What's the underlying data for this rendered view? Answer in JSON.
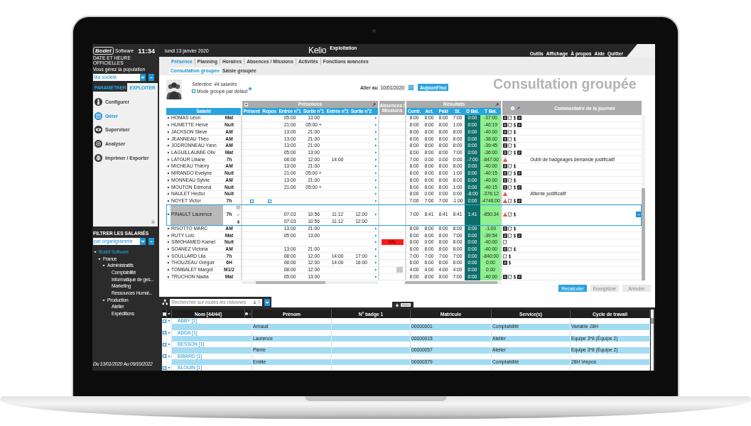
{
  "sidebar": {
    "logo": {
      "name": "Bodet",
      "subtitle": "Software",
      "tagline": "DATE ET HEURE OFFICIELLES"
    },
    "clock": "11:34",
    "population_label": "Vous gérez la population",
    "population_select": {
      "value": "Ma société"
    },
    "mode_tabs": [
      {
        "label": "PARAMÉTRER",
        "selected": false
      },
      {
        "label": "EXPLOITER",
        "selected": true
      }
    ],
    "menu": [
      {
        "label": "Configurer",
        "selected": false
      },
      {
        "label": "Gérer",
        "selected": true
      },
      {
        "label": "Superviser",
        "selected": false
      },
      {
        "label": "Analyser",
        "selected": false
      },
      {
        "label": "Imprimer / Exporter",
        "selected": false
      }
    ],
    "filter_title": "FILTRER LES SALARIÉS",
    "filter_select": {
      "value": "par organigramme"
    },
    "tree": [
      {
        "label": "Bodet Software",
        "selected": true,
        "expanded": true,
        "children": [
          {
            "label": "France",
            "selected": false,
            "expanded": true,
            "children": [
              {
                "label": "Administratifs",
                "selected": false,
                "expanded": true,
                "children": [
                  {
                    "label": "Comptabilité",
                    "selected": false
                  },
                  {
                    "label": "Informatique de ges...",
                    "selected": false
                  },
                  {
                    "label": "Marketing",
                    "selected": false
                  },
                  {
                    "label": "Ressources Humai...",
                    "selected": false
                  }
                ]
              },
              {
                "label": "Production",
                "selected": false,
                "expanded": true,
                "children": [
                  {
                    "label": "Atelier",
                    "selected": false
                  },
                  {
                    "label": "Expéditions",
                    "selected": false
                  }
                ]
              }
            ]
          }
        ]
      }
    ],
    "period": "Du 13/01/2020 Au 09/10/2022"
  },
  "topbar": {
    "date": "lundi 13 janvier 2020",
    "logo": "Kelio",
    "module": "Exploitation",
    "menu": [
      "Outils",
      "Affichage",
      "À propos",
      "Aide",
      "Quitter"
    ]
  },
  "tabs": [
    {
      "label": "Présence",
      "selected": true
    },
    {
      "label": "Planning",
      "selected": false
    },
    {
      "label": "Horaires",
      "selected": false
    },
    {
      "label": "Absences / Missions",
      "selected": false
    },
    {
      "label": "Activités",
      "selected": false
    },
    {
      "label": "Fonctions avancées",
      "selected": false
    }
  ],
  "subtabs": [
    {
      "label": "Consultation groupée",
      "selected": true
    },
    {
      "label": "Saisie groupée",
      "selected": false
    }
  ],
  "consultation": {
    "selection": "Sélection: 44 salariés",
    "grouped_mode": {
      "label": "Mode groupé par défaut",
      "checked": false
    },
    "goto": {
      "label": "Aller au",
      "value": "10/01/2020",
      "today_button": "Aujourd'hui"
    },
    "title": "Consultation groupée"
  },
  "grid": {
    "employee_header": "Salarié",
    "presences": {
      "title": "Présences",
      "columns": [
        "Présent",
        "Repos",
        "Entrée n°1",
        "Sortie n°1",
        "Entrée n°2",
        "Sortie n°2"
      ]
    },
    "absences_header": "Absences / Missions",
    "results": {
      "title": "Résultats",
      "columns": [
        "Contr.",
        "Act.",
        "Paid",
        "St.",
        "D Bal.",
        "T Bal."
      ]
    },
    "comment_header": "Commentaire de la journée",
    "rows": [
      {
        "name": "HOMAS Léon",
        "cycle": "Mat",
        "selected": false,
        "expanded": false,
        "punches": [
          "05:00",
          "13:00"
        ],
        "results": [
          "8:00",
          "8:00",
          "8:00",
          "7:00",
          "0:00",
          "-37:00"
        ],
        "flags": {
          "warning": false,
          "schedule": true,
          "note": true,
          "pay": true,
          "swap": true
        }
      },
      {
        "name": "HUMETTE Hervé",
        "cycle": "Nuit",
        "selected": false,
        "expanded": false,
        "punches": [
          "21:00",
          "05:00 +"
        ],
        "results": [
          "8:00",
          "8:00",
          "8:00",
          "1:00",
          "0:00",
          "-40:19"
        ],
        "flags": {
          "warning": false,
          "schedule": true,
          "note": true,
          "pay": true,
          "swap": true
        }
      },
      {
        "name": "JACKSON Steve",
        "cycle": "AM",
        "selected": false,
        "expanded": false,
        "punches": [
          "13:00",
          "21:00"
        ],
        "results": [
          "8:00",
          "8:00",
          "8:00",
          "8:00",
          "0:00",
          "-40:00"
        ],
        "flags": {
          "warning": false,
          "schedule": true,
          "note": true,
          "pay": true,
          "swap": false
        }
      },
      {
        "name": "JEANNEAU Théo",
        "cycle": "AM",
        "selected": false,
        "expanded": false,
        "punches": [
          "13:00",
          "21:00"
        ],
        "results": [
          "8:00",
          "8:00",
          "8:00",
          "8:00",
          "0:00",
          "-38:00"
        ],
        "flags": {
          "warning": false,
          "schedule": true,
          "note": true,
          "pay": true,
          "swap": false
        }
      },
      {
        "name": "JODRONNEAU Yann",
        "cycle": "AM",
        "selected": false,
        "expanded": false,
        "punches": [
          "13:00",
          "21:00"
        ],
        "results": [
          "8:00",
          "8:00",
          "8:00",
          "8:00",
          "0:00",
          "-39:45"
        ],
        "flags": {
          "warning": false,
          "schedule": true,
          "note": true,
          "pay": true,
          "swap": false
        }
      },
      {
        "name": "LAGUILLAUMIE Oliv",
        "cycle": "Mat",
        "selected": false,
        "expanded": false,
        "punches": [
          "05:00",
          "13:00"
        ],
        "results": [
          "8:00",
          "8:00",
          "8:00",
          "7:00",
          "0:00",
          "-36:00"
        ],
        "flags": {
          "warning": false,
          "schedule": true,
          "note": true,
          "pay": true,
          "swap": true
        }
      },
      {
        "name": "LATOUR Liliane",
        "cycle": "7h",
        "selected": false,
        "expanded": false,
        "punches": [
          "08:00",
          "12:00",
          "14:00"
        ],
        "results": [
          "7:00",
          "0:00",
          "0:00",
          "0:00",
          "-7:00",
          "-847:00"
        ],
        "flags": {
          "warning": true,
          "schedule": false,
          "note": false,
          "pay": false,
          "swap": false
        },
        "comment": "Oubli de badgeages demande justificatif"
      },
      {
        "name": "MICHEAU Thierry",
        "cycle": "AM",
        "selected": false,
        "expanded": false,
        "punches": [
          "13:00",
          "21:00"
        ],
        "results": [
          "8:00",
          "8:00",
          "8:00",
          "8:00",
          "0:00",
          "-40:00"
        ],
        "flags": {
          "warning": false,
          "schedule": true,
          "note": true,
          "pay": true,
          "swap": false
        }
      },
      {
        "name": "MIRANDO Evelyne",
        "cycle": "Nuit",
        "selected": false,
        "expanded": false,
        "punches": [
          "21:00",
          "05:00 +"
        ],
        "results": [
          "8:00",
          "8:00",
          "8:00",
          "1:00",
          "0:00",
          "-40:15"
        ],
        "flags": {
          "warning": false,
          "schedule": true,
          "note": true,
          "pay": true,
          "swap": true
        }
      },
      {
        "name": "MONNEAU Sylvie",
        "cycle": "AM",
        "selected": false,
        "expanded": false,
        "punches": [
          "13:00",
          "21:00"
        ],
        "results": [
          "8:00",
          "8:00",
          "8:00",
          "8:00",
          "0:00",
          "-40:00"
        ],
        "flags": {
          "warning": false,
          "schedule": true,
          "note": true,
          "pay": true,
          "swap": false
        }
      },
      {
        "name": "MOUTON Edmond",
        "cycle": "Nuit",
        "selected": false,
        "expanded": false,
        "punches": [
          "21:00",
          "05:00 +"
        ],
        "results": [
          "8:00",
          "8:00",
          "8:00",
          "1:00",
          "0:00",
          "-40:15"
        ],
        "flags": {
          "warning": false,
          "schedule": true,
          "note": true,
          "pay": true,
          "swap": true
        }
      },
      {
        "name": "NAULET Hector",
        "cycle": "Nuit",
        "selected": false,
        "expanded": false,
        "results": [
          "8:00",
          "0:00",
          "0:00",
          "0:00",
          "-8:00",
          "-376:12"
        ],
        "flags": {
          "warning": true,
          "schedule": false,
          "note": false,
          "pay": false,
          "swap": false
        },
        "comment": "Attente justificatif"
      },
      {
        "name": "NOYET Victor",
        "cycle": "7h",
        "selected": false,
        "expanded": false,
        "present": true,
        "rest": true,
        "results": [
          "7:00",
          "7:00",
          "7:00",
          "-1:00",
          "0:00",
          "-4746:00"
        ],
        "flags": {
          "warning": true,
          "schedule": false,
          "note": true,
          "pay": true,
          "swap": true
        }
      },
      {
        "name": "PINAULT Laurence",
        "cycle": "7h",
        "selected": true,
        "expanded": true,
        "punches": [
          "07:03",
          "10:56",
          "11:12",
          "12:00"
        ],
        "detail_punches": [
          "07:03",
          "10:56",
          "11:12",
          "12:00"
        ],
        "results": [
          "7:00",
          "8:41",
          "8:41",
          "8:41",
          "1:41",
          "-850:34"
        ],
        "flags": {
          "warning": true,
          "schedule": false,
          "note": true,
          "pay": true,
          "swap": false
        }
      },
      {
        "name": "RISOTTO MARC",
        "cycle": "AM",
        "selected": false,
        "expanded": false,
        "punches": [
          "13:00",
          "21:00"
        ],
        "results": [
          "8:00",
          "8:00",
          "8:00",
          "8:00",
          "0:00",
          "-1:00"
        ],
        "flags": {
          "warning": false,
          "schedule": true,
          "note": true,
          "pay": true,
          "swap": false
        }
      },
      {
        "name": "RUTY Loïc",
        "cycle": "Mat",
        "selected": false,
        "expanded": false,
        "punches": [
          "05:00",
          "13:00"
        ],
        "results": [
          "8:00",
          "8:00",
          "8:00",
          "7:00",
          "0:00",
          "-39:54"
        ],
        "flags": {
          "warning": false,
          "schedule": true,
          "note": true,
          "pay": true,
          "swap": true
        }
      },
      {
        "name": "SIMOHAMED Kamel",
        "cycle": "Nuit",
        "selected": false,
        "expanded": false,
        "absence": {
          "label": "VAL",
          "color": "#ff1a1a"
        },
        "results": [
          "8:00",
          "0:00",
          "8:00",
          "8:00",
          "0:00",
          "-40:00"
        ],
        "flags": {
          "warning": false,
          "schedule": false,
          "note": true,
          "pay": false,
          "swap": false
        }
      },
      {
        "name": "SOANEZ Victoria",
        "cycle": "AM",
        "selected": false,
        "expanded": false,
        "punches": [
          "13:00",
          "21:00"
        ],
        "results": [
          "8:00",
          "8:00",
          "8:00",
          "8:00",
          "0:00",
          "-40:00"
        ],
        "flags": {
          "warning": false,
          "schedule": true,
          "note": true,
          "pay": true,
          "swap": false
        }
      },
      {
        "name": "SOULLARD Lila",
        "cycle": "7h",
        "selected": false,
        "expanded": false,
        "punches": [
          "08:00",
          "12:00",
          "14:00",
          "17:00"
        ],
        "results": [
          "7:00",
          "7:00",
          "7:00",
          "7:00",
          "0:00",
          "-840:00"
        ],
        "flags": {
          "warning": false,
          "schedule": false,
          "note": true,
          "pay": true,
          "swap": false
        }
      },
      {
        "name": "THOUZEAU Grégoir",
        "cycle": "6H",
        "selected": false,
        "expanded": false,
        "punches": [
          "08:00",
          "12:00",
          "14:00",
          "16:00"
        ],
        "results": [
          "6:00",
          "6:00",
          "6:00",
          "6:00",
          "0:00",
          "0:00"
        ],
        "flags": {
          "warning": false,
          "schedule": true,
          "note": false,
          "pay": true,
          "swap": false
        }
      },
      {
        "name": "TOMBALET Margot",
        "cycle": "M1/2",
        "selected": false,
        "expanded": false,
        "punches": [
          "08:00",
          "12:00"
        ],
        "absence": {
          "color": "#c8c8c8"
        },
        "results": [
          "4:00",
          "4:00",
          "4:00",
          "4:00",
          "0:00",
          "0:00"
        ],
        "flags": {
          "warning": false,
          "schedule": false,
          "note": false,
          "pay": false,
          "swap": false
        }
      },
      {
        "name": "TRUCHON Nadia",
        "cycle": "Mat",
        "selected": false,
        "expanded": false,
        "punches": [
          "05:00",
          "13:00"
        ],
        "results": [
          "8:00",
          "8:00",
          "8:00",
          "7:00",
          "0:00",
          "-40:00"
        ],
        "flags": {
          "warning": false,
          "schedule": true,
          "note": true,
          "pay": true,
          "swap": true
        }
      }
    ]
  },
  "actions": [
    {
      "label": "Recalculer",
      "disabled": false
    },
    {
      "label": "Enregistrer",
      "disabled": true
    },
    {
      "label": "Annuler",
      "disabled": true
    }
  ],
  "employee_list": {
    "search": {
      "placeholder": "Rechercher sur toutes les colonnes"
    },
    "all_checked": true,
    "columns": [
      "Nom [44/44]",
      "Prénom",
      "N° badge 1",
      "Matricule",
      "Service(s)",
      "Cycle de travail"
    ],
    "groups": [
      {
        "name": "ABBY [1]",
        "checked": true,
        "expanded": true,
        "members": [
          {
            "first_name": "Arnaud",
            "employee_id": "00000001",
            "service": "Comptabilité",
            "cycle": "Variable 28H"
          }
        ]
      },
      {
        "name": "ADDA [1]",
        "checked": true,
        "expanded": true,
        "members": [
          {
            "first_name": "Laurence",
            "employee_id": "00000015",
            "service": "Atelier",
            "cycle": "Equipe 3*8 (Équipe 2)"
          }
        ]
      },
      {
        "name": "BESSON [1]",
        "checked": true,
        "expanded": true,
        "members": [
          {
            "first_name": "Pierre",
            "employee_id": "00000057",
            "service": "Atelier",
            "cycle": "Equipe 3*8 (Équipe 2)"
          }
        ]
      },
      {
        "name": "BIBARD [1]",
        "checked": true,
        "expanded": true,
        "members": [
          {
            "first_name": "Emilie",
            "employee_id": "00000379",
            "service": "Comptabilité",
            "cycle": "28H Vrepos"
          }
        ]
      },
      {
        "name": "BLOUIN [1]",
        "checked": true,
        "expanded": true
      }
    ]
  }
}
